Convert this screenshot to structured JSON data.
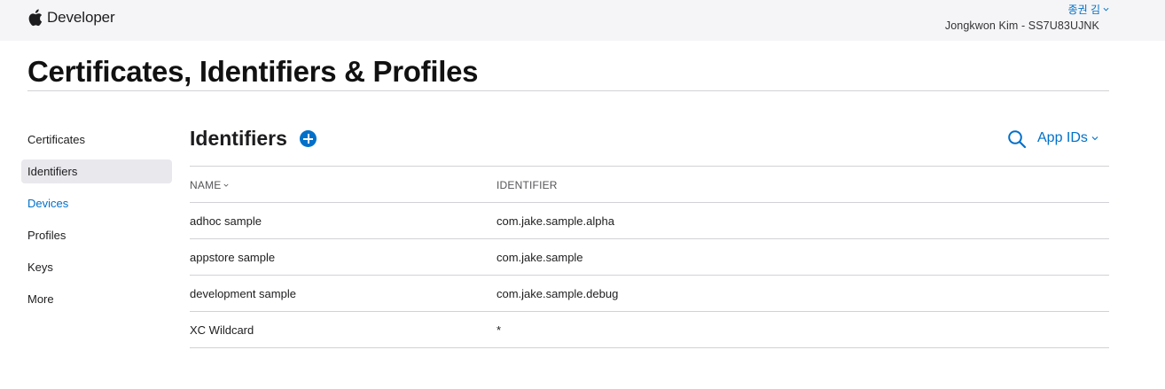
{
  "header": {
    "brand": "Developer",
    "account_name": "종권 김",
    "team": "Jongkwon Kim - SS7U83UJNK"
  },
  "page": {
    "title": "Certificates, Identifiers & Profiles"
  },
  "sidebar": {
    "items": [
      {
        "label": "Certificates",
        "state": "normal"
      },
      {
        "label": "Identifiers",
        "state": "active"
      },
      {
        "label": "Devices",
        "state": "link"
      },
      {
        "label": "Profiles",
        "state": "normal"
      },
      {
        "label": "Keys",
        "state": "normal"
      },
      {
        "label": "More",
        "state": "normal"
      }
    ]
  },
  "main": {
    "section_title": "Identifiers",
    "filter_label": "App IDs",
    "columns": [
      "NAME",
      "IDENTIFIER"
    ],
    "rows": [
      {
        "name": "adhoc sample",
        "identifier": "com.jake.sample.alpha"
      },
      {
        "name": "appstore sample",
        "identifier": "com.jake.sample"
      },
      {
        "name": "development sample",
        "identifier": "com.jake.sample.debug"
      },
      {
        "name": "XC Wildcard",
        "identifier": "*"
      }
    ]
  },
  "icons": {
    "brand": "apple-logo-icon",
    "add": "plus-circle-icon",
    "search": "search-icon",
    "dropdown": "chevron-down-icon"
  },
  "colors": {
    "accent": "#0070c9",
    "topbar_bg": "#f5f5f7",
    "active_bg": "#e8e8ed",
    "divider": "#d2d2d7"
  }
}
